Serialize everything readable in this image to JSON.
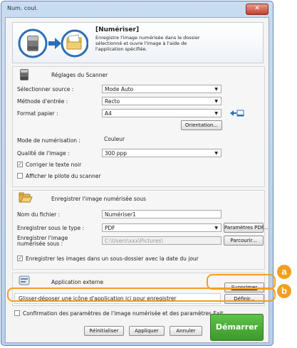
{
  "window": {
    "title": "Num. coul.",
    "close_glyph": "✕"
  },
  "banner": {
    "title": "[Numériser]",
    "description_lines": [
      "Enregistre l'image numérisée dans le dossier",
      "sélectionné et ouvre l'image à l'aide de",
      "l'application spécifiée."
    ],
    "icons": [
      "scanner-icon",
      "arrow-right-icon",
      "folder-icon"
    ]
  },
  "scanner": {
    "heading": "Réglages du Scanner",
    "source_label": "Sélectionner source :",
    "source_value": "Mode Auto",
    "input_method_label": "Méthode d'entrée :",
    "input_method_value": "Recto",
    "paper_label": "Format papier :",
    "paper_value": "A4",
    "orientation_button": "Orientation...",
    "scan_mode_label": "Mode de numérisation :",
    "scan_mode_value": "Couleur",
    "quality_label": "Qualité de l'image :",
    "quality_value": "300 ppp",
    "correct_text_label": "Corriger le texte noir",
    "correct_text_checked": true,
    "show_driver_label": "Afficher le pilote du scanner",
    "show_driver_checked": false
  },
  "save": {
    "heading": "Enregistrer l'image numérisée sous",
    "filename_label": "Nom du fichier :",
    "filename_value": "Numériser1",
    "type_label": "Enregistrer sous le type :",
    "type_value": "PDF",
    "pdf_params_button": "Paramètres PDF...",
    "location_label_lines": [
      "Enregistrer l'image",
      "numérisée sous :"
    ],
    "location_value": "C:\\Users\\xxx\\Pictures\\",
    "browse_button": "Parcourir...",
    "subfolder_label": "Enregistrer les images dans un sous-dossier avec la date du jour",
    "subfolder_checked": true
  },
  "app": {
    "heading": "Application externe",
    "delete_button": "Supprimer",
    "dropzone_text": "Glisser-déposer une icône d'application ici pour enregistrer",
    "define_button": "Définir..."
  },
  "footer": {
    "confirm_label": "Confirmation des paramètres de l'image numérisée et des paramètres Exit",
    "confirm_checked": false,
    "reset_button": "Réinitialiser",
    "apply_button": "Appliquer",
    "cancel_button": "Annuler",
    "start_button": "Démarrer"
  },
  "callouts": {
    "a": "a",
    "b": "b"
  },
  "colors": {
    "callout": "#f0a020",
    "start_button": "#3c9a2a"
  }
}
